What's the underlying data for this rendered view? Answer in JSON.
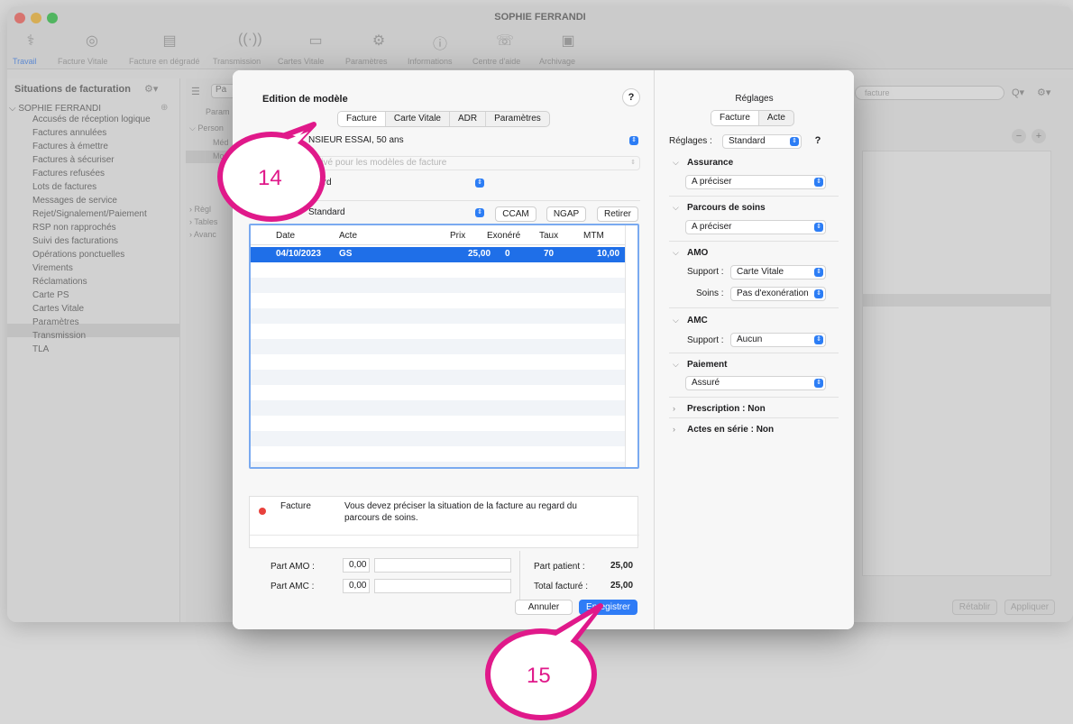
{
  "window": {
    "title": "SOPHIE FERRANDI",
    "toolbar": [
      "Travail",
      "Facture Vitale",
      "Facture en dégradé",
      "Transmission",
      "Cartes Vitale",
      "Paramètres",
      "Informations",
      "Centre d'aide",
      "Archivage"
    ],
    "search_placeholder": "facture"
  },
  "sidebar": {
    "header": "Situations de facturation",
    "root": "SOPHIE FERRANDI",
    "items": [
      "Accusés de réception logique",
      "Factures annulées",
      "Factures à émettre",
      "Factures à sécuriser",
      "Factures refusées",
      "Lots de factures",
      "Messages de service",
      "Rejet/Signalement/Paiement",
      "RSP non rapprochés",
      "Suivi des facturations",
      "Opérations ponctuelles",
      "Virements",
      "Réclamations",
      "Carte PS",
      "Cartes Vitale",
      "Paramètres",
      "Transmission",
      "TLA"
    ],
    "selected_index": 15
  },
  "middle_panel": {
    "header": "Pa",
    "tree": [
      "Param",
      "Person",
      "Méd",
      "Mo",
      "Règl",
      "Tables",
      "Avanc"
    ]
  },
  "bg_buttons": {
    "retablir": "Rétablir",
    "appliquer": "Appliquer"
  },
  "dialog": {
    "title": "Edition de modèle",
    "help": "?",
    "tabs": [
      "Facture",
      "Carte Vitale",
      "ADR",
      "Paramètres"
    ],
    "patient": "NSIEUR ESSAI, 50 ans",
    "disabled_text": "activé pour les modèles de facture",
    "popup1": "ndard",
    "popup2": "Standard",
    "buttons": {
      "ccam": "CCAM",
      "ngap": "NGAP",
      "retirer": "Retirer",
      "annuler": "Annuler",
      "enregistrer": "Enregistrer"
    },
    "table": {
      "columns": [
        "Date",
        "Acte",
        "Prix",
        "Exonéré",
        "Taux",
        "MTM"
      ],
      "rows": [
        {
          "date": "04/10/2023",
          "acte": "GS",
          "prix": "25,00",
          "exonere": "0",
          "taux": "70",
          "mtm": "10,00"
        }
      ]
    },
    "message": {
      "category": "Facture",
      "text_line1": "Vous devez préciser la situation de la facture au regard du",
      "text_line2": "parcours de soins.",
      "dot_color": "#e8413c"
    },
    "totals": {
      "part_amo_label": "Part AMO :",
      "part_amo": "0,00",
      "part_amc_label": "Part AMC :",
      "part_amc": "0,00",
      "part_patient_label": "Part patient :",
      "part_patient": "25,00",
      "total_label": "Total facturé :",
      "total": "25,00"
    }
  },
  "reglages": {
    "title": "Réglages",
    "tabs": [
      "Facture",
      "Acte"
    ],
    "reglages_label": "Réglages :",
    "reglages_value": "Standard",
    "sections": {
      "assurance": {
        "title": "Assurance",
        "value": "A préciser"
      },
      "parcours": {
        "title": "Parcours de soins",
        "value": "A préciser"
      },
      "amo": {
        "title": "AMO",
        "support_label": "Support :",
        "support": "Carte Vitale",
        "soins_label": "Soins :",
        "soins": "Pas d'exonération"
      },
      "amc": {
        "title": "AMC",
        "support_label": "Support :",
        "support": "Aucun"
      },
      "paiement": {
        "title": "Paiement",
        "value": "Assuré"
      },
      "prescription": "Prescription : Non",
      "actes_serie": "Actes en série : Non"
    }
  },
  "callouts": {
    "a": "14",
    "b": "15"
  },
  "colors": {
    "accent": "#2f7cf6",
    "callout": "#e0198a",
    "selection": "#1f6fe8"
  }
}
